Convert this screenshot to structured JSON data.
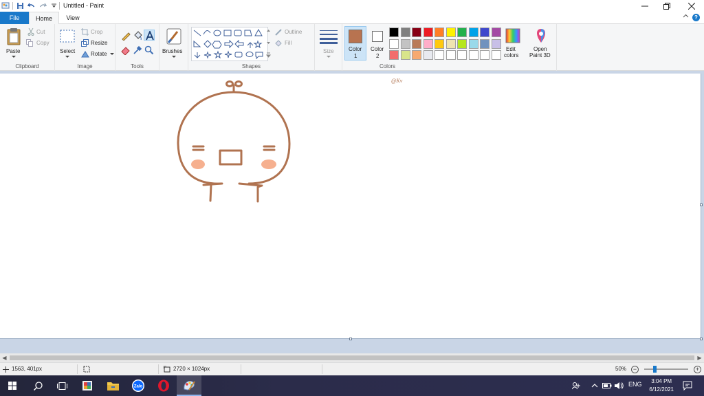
{
  "window": {
    "title": "Untitled - Paint"
  },
  "tabs": {
    "file": "File",
    "home": "Home",
    "view": "View"
  },
  "ribbon": {
    "clipboard": {
      "label": "Clipboard",
      "paste": "Paste",
      "cut": "Cut",
      "copy": "Copy"
    },
    "image": {
      "label": "Image",
      "select": "Select",
      "crop": "Crop",
      "resize": "Resize",
      "rotate": "Rotate"
    },
    "tools": {
      "label": "Tools"
    },
    "brushes": {
      "label": "Brushes"
    },
    "shapes": {
      "label": "Shapes",
      "outline": "Outline",
      "fill": "Fill"
    },
    "size": {
      "label": "Size"
    },
    "colors": {
      "label": "Colors",
      "color1_label": "Color",
      "color1_num": "1",
      "color2_label": "Color",
      "color2_num": "2",
      "color1_value": "#b87350",
      "color2_value": "#ffffff",
      "edit_colors": "Edit",
      "edit_colors2": "colors",
      "palette_row1": [
        "#000000",
        "#7f7f7f",
        "#880015",
        "#ed1c24",
        "#ff7f27",
        "#fff200",
        "#22b14c",
        "#00a2e8",
        "#3f48cc",
        "#a349a4"
      ],
      "palette_row2": [
        "#ffffff",
        "#c3c3c3",
        "#b97a57",
        "#ffaec9",
        "#ffc90e",
        "#efe4b0",
        "#b5e61d",
        "#99d9ea",
        "#7092be",
        "#c8bfe7"
      ],
      "palette_row3": [
        "#f26d6d",
        "#d9e58a",
        "#f7a96f",
        "#e8eaf0",
        "#ffffff",
        "#ffffff",
        "#ffffff",
        "#ffffff",
        "#ffffff",
        "#ffffff"
      ]
    },
    "paint3d": {
      "line1": "Open",
      "line2": "Paint 3D"
    }
  },
  "canvas": {
    "drawing_color": "#b07350",
    "cheek_color": "#f6b08f",
    "signature": "@Kv"
  },
  "statusbar": {
    "cursor_pos": "1563, 401px",
    "image_size": "2720 × 1024px",
    "zoom": "50%"
  },
  "taskbar": {
    "lang": "ENG",
    "time": "3:04 PM",
    "date": "6/12/2021",
    "zalo": "Zalo"
  }
}
